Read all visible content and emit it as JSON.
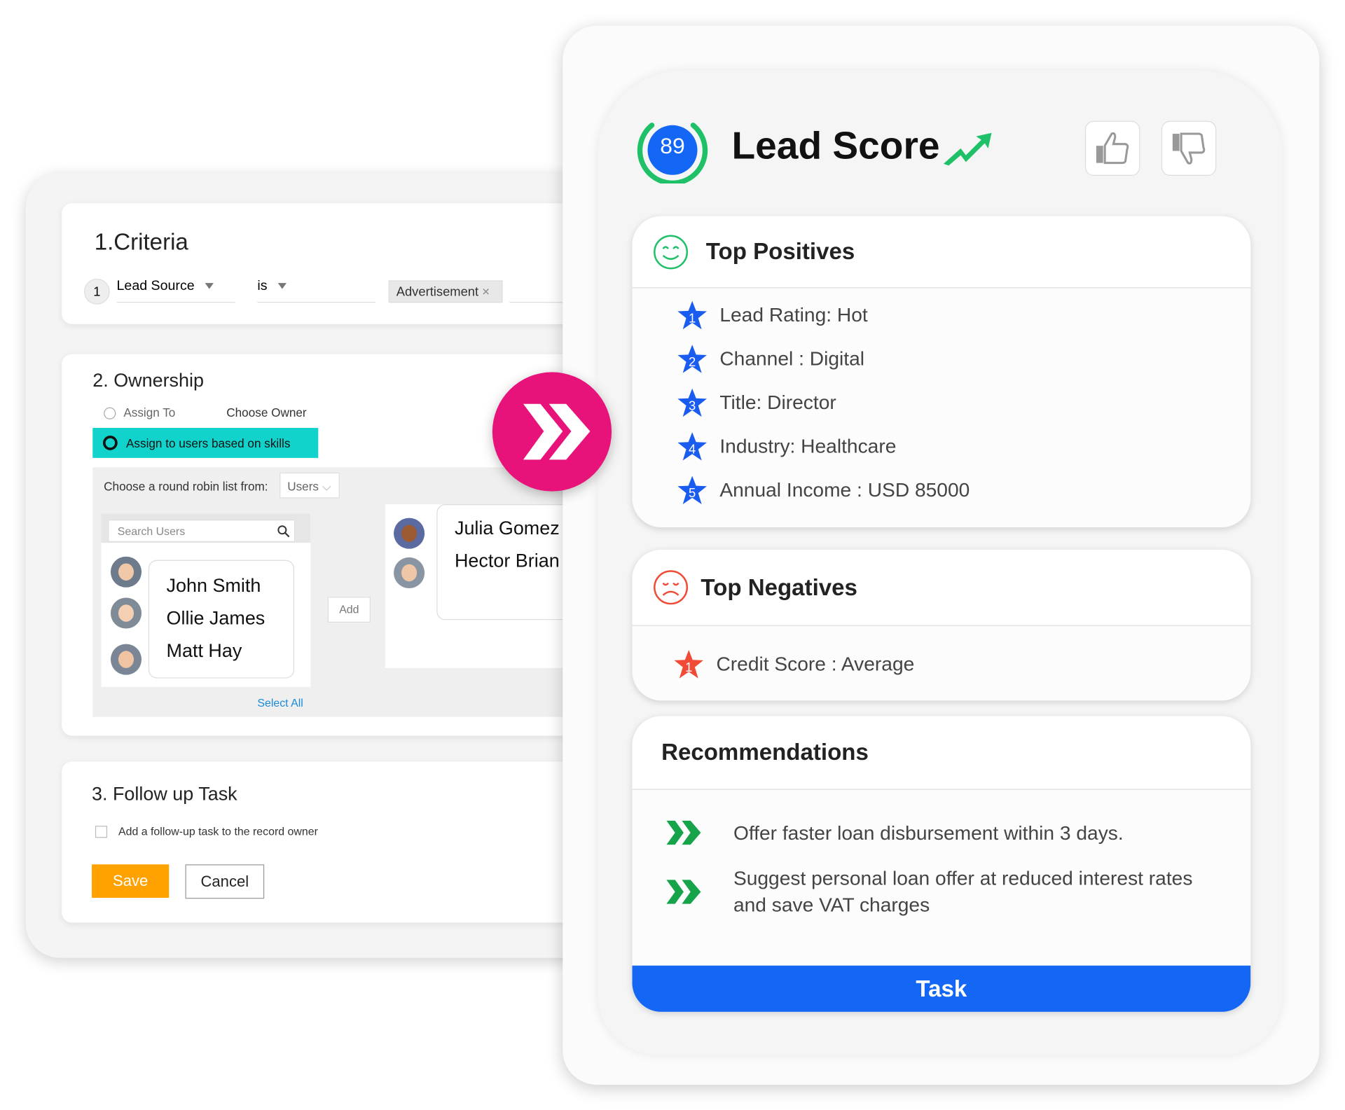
{
  "criteria": {
    "title": "1.Criteria",
    "row_number": "1",
    "field": "Lead Source",
    "operator": "is",
    "value_tag": "Advertisement"
  },
  "ownership": {
    "title": "2. Ownership",
    "assign_to": "Assign To",
    "choose_owner": "Choose Owner",
    "assign_skills": "Assign to users based on skills",
    "round_robin_label": "Choose a round robin list from:",
    "round_robin_value": "Users",
    "search_placeholder": "Search Users",
    "users": [
      "John Smith",
      "Ollie James",
      "Matt Hay"
    ],
    "add_label": "Add",
    "select_all": "Select All",
    "selected_users": [
      "Julia Gomez",
      "Hector Brian"
    ]
  },
  "followup": {
    "title": "3. Follow up Task",
    "checkbox_label": "Add a follow-up task to the record owner",
    "save": "Save",
    "cancel": "Cancel"
  },
  "lead_score": {
    "score": "89",
    "title": "Lead Score",
    "trend_icon": "trend-up-icon",
    "thumbs": [
      "thumbs-up-icon",
      "thumbs-down-icon"
    ]
  },
  "positives": {
    "title": "Top Positives",
    "items": [
      {
        "rank": "1",
        "text": "Lead Rating: Hot"
      },
      {
        "rank": "2",
        "text": "Channel : Digital"
      },
      {
        "rank": "3",
        "text": "Title: Director"
      },
      {
        "rank": "4",
        "text": "Industry: Healthcare"
      },
      {
        "rank": "5",
        "text": "Annual Income : USD 85000"
      }
    ]
  },
  "negatives": {
    "title": "Top Negatives",
    "items": [
      {
        "rank": "1",
        "text": "Credit Score : Average"
      }
    ]
  },
  "recommendations": {
    "title": "Recommendations",
    "items": [
      "Offer faster loan disbursement within 3 days.",
      "Suggest personal loan offer at reduced interest rates and save VAT charges"
    ],
    "task_label": "Task"
  },
  "colors": {
    "accent_pink": "#e8137a",
    "teal": "#12d3cc",
    "save_orange": "#ffa200",
    "task_blue": "#1466f5",
    "star_blue": "#1a5cf0",
    "star_red": "#ef4b37",
    "green": "#1ec168"
  }
}
